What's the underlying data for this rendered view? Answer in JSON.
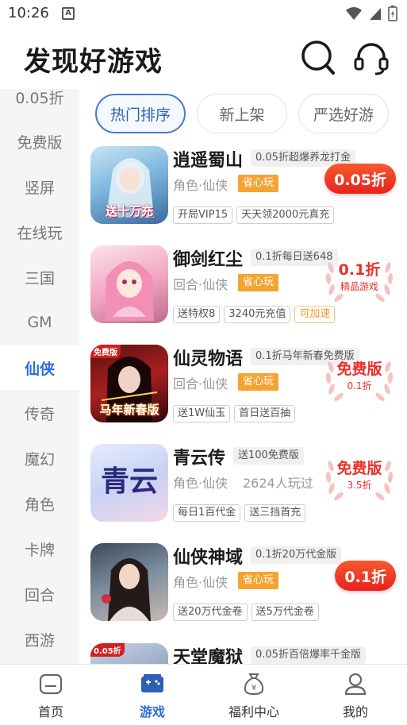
{
  "status": {
    "time": "10:26",
    "notif_icon": "a-icon"
  },
  "header": {
    "title": "发现好游戏",
    "icons": [
      "search-icon",
      "headset-icon"
    ]
  },
  "sidebar": {
    "items": [
      {
        "label": "0.05折"
      },
      {
        "label": "免费版"
      },
      {
        "label": "竖屏"
      },
      {
        "label": "在线玩"
      },
      {
        "label": "三国"
      },
      {
        "label": "GM"
      },
      {
        "label": "仙侠",
        "active": true
      },
      {
        "label": "传奇"
      },
      {
        "label": "魔幻"
      },
      {
        "label": "角色"
      },
      {
        "label": "卡牌"
      },
      {
        "label": "回合"
      },
      {
        "label": "西游"
      }
    ]
  },
  "tabs": [
    {
      "label": "热门排序",
      "active": true
    },
    {
      "label": "新上架"
    },
    {
      "label": "严选好游"
    }
  ],
  "games": [
    {
      "name": "逍遥蜀山",
      "promo": "0.05折超爆养龙打金",
      "category": "角色·仙侠",
      "worry_free": "省心玩",
      "tags": [
        "开局VIP15",
        "天天领2000元真充"
      ],
      "badge": "0.05折",
      "icon_caption": "送十万充"
    },
    {
      "name": "御剑红尘",
      "promo": "0.1折每日送648",
      "category": "回合·仙侠",
      "worry_free": "省心玩",
      "tags": [
        "送特权8",
        "3240元充值"
      ],
      "tag_orange": "可加速",
      "laurel_main": "0.1折",
      "laurel_sub": "精品游戏"
    },
    {
      "name": "仙灵物语",
      "promo": "0.1折马年新春免费版",
      "category": "回合·仙侠",
      "worry_free": "省心玩",
      "tags": [
        "送1W仙玉",
        "首日送百抽"
      ],
      "laurel_main": "免费版",
      "laurel_sub": "0.1折",
      "icon_corner": "免费版",
      "icon_caption": "马年新春版"
    },
    {
      "name": "青云传",
      "promo": "送100免费版",
      "category": "角色·仙侠",
      "players": "2624人玩过",
      "tags": [
        "每日1百代金",
        "送三挡首充"
      ],
      "laurel_main": "免费版",
      "laurel_sub": "3.5折",
      "icon_caption": "青云"
    },
    {
      "name": "仙侠神域",
      "promo": "0.1折20万代金版",
      "category": "角色·仙侠",
      "worry_free": "省心玩",
      "tags": [
        "送20万代金卷",
        "送5万代金卷"
      ],
      "badge": "0.1折"
    },
    {
      "name": "天堂魔狱",
      "promo": "0.05折百倍爆率千金版",
      "icon_corner": "0.05折"
    }
  ],
  "bottom_nav": [
    {
      "label": "首页",
      "icon": "home-icon"
    },
    {
      "label": "游戏",
      "icon": "gamepad-icon",
      "active": true
    },
    {
      "label": "福利中心",
      "icon": "money-bag-icon"
    },
    {
      "label": "我的",
      "icon": "user-icon"
    }
  ],
  "colors": {
    "accent": "#2a6ed8",
    "badge_red": "#e7221e",
    "worry_orange": "#f5a433"
  }
}
